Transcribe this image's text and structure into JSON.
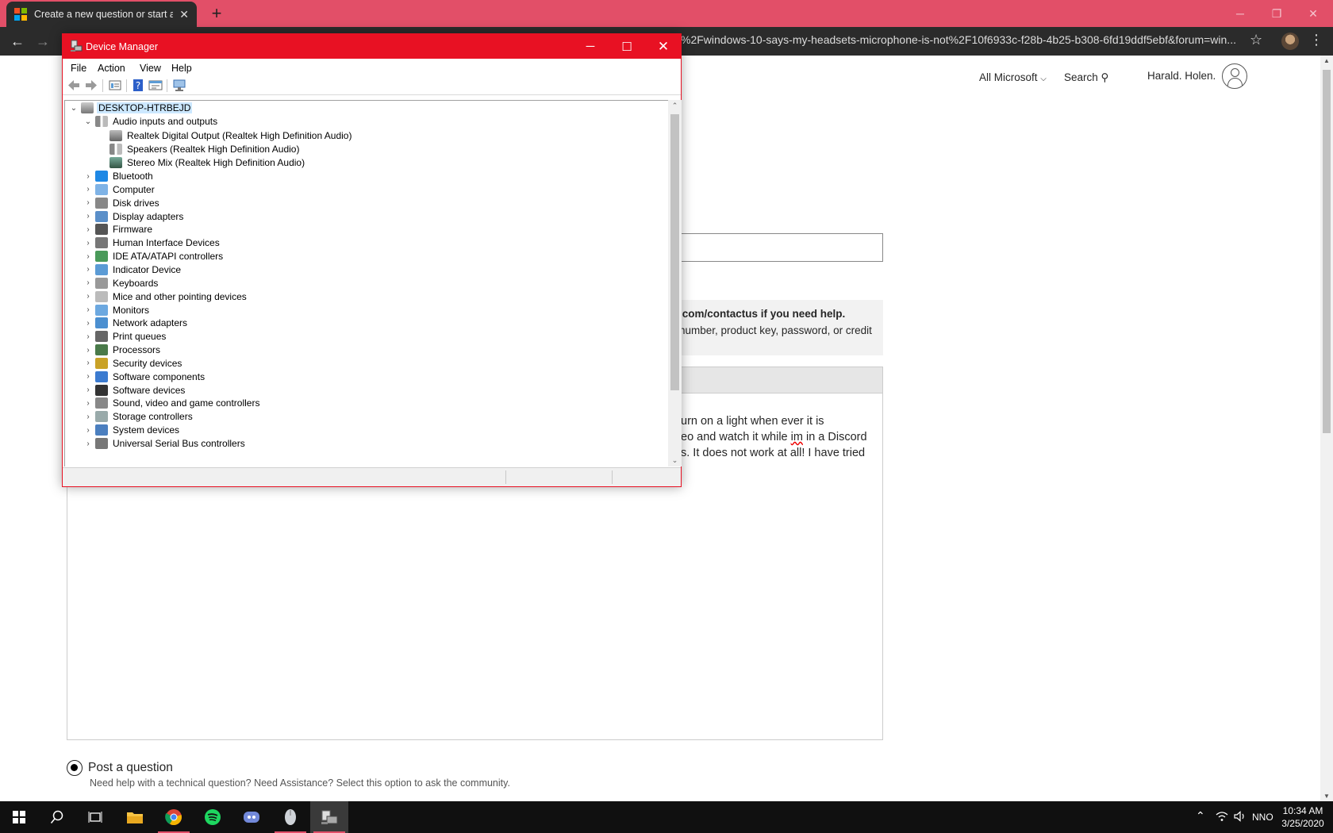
{
  "browser": {
    "tab_title": "Create a new question or start a d",
    "new_tab": "+",
    "url": "%2Fwindows-10-says-my-headsets-microphone-is-not%2F10f6933c-f28b-4b25-b308-6fd19ddf5ebf&forum=win..."
  },
  "ms_header": {
    "all_microsoft": "All Microsoft",
    "search": "Search",
    "user": "Harald. Holen."
  },
  "page": {
    "notice_line1": ".com/contactus if you need help.",
    "notice_line2": "number, product key, password, or credit",
    "editor_line1": "urn on a light when ever it is",
    "editor_line2_pre": "eo and watch it while ",
    "editor_line2_im": "im",
    "editor_line2_post": " in a Discord",
    "editor_line3": "s. It does not work at all! I have tried",
    "post_title": "Post a question",
    "post_desc": "Need help with a technical question? Need Assistance? Select this option to ask the community."
  },
  "device_manager": {
    "title": "Device Manager",
    "menu": [
      "File",
      "Action",
      "View",
      "Help"
    ],
    "root": "DESKTOP-HTRBEJD",
    "audio_category": "Audio inputs and outputs",
    "audio_children": [
      "Realtek Digital Output (Realtek High Definition Audio)",
      "Speakers (Realtek High Definition Audio)",
      "Stereo Mix (Realtek High Definition Audio)"
    ],
    "categories": [
      "Bluetooth",
      "Computer",
      "Disk drives",
      "Display adapters",
      "Firmware",
      "Human Interface Devices",
      "IDE ATA/ATAPI controllers",
      "Indicator Device",
      "Keyboards",
      "Mice and other pointing devices",
      "Monitors",
      "Network adapters",
      "Print queues",
      "Processors",
      "Security devices",
      "Software components",
      "Software devices",
      "Sound, video and game controllers",
      "Storage controllers",
      "System devices",
      "Universal Serial Bus controllers"
    ]
  },
  "taskbar": {
    "language": "NNO",
    "time": "10:34 AM",
    "date": "3/25/2020"
  },
  "colors": {
    "accent": "#e81123",
    "browser_accent": "#e24f68"
  }
}
